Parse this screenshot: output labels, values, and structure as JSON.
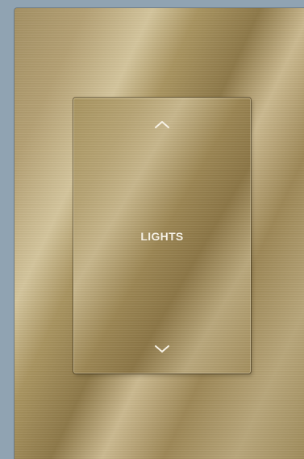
{
  "switch": {
    "label": "LIGHTS",
    "up_icon": "chevron-up-icon",
    "down_icon": "chevron-down-icon"
  },
  "colors": {
    "background": "#90a3b2",
    "metal_brass": "#b3a072",
    "label_text": "#f7f2e6"
  }
}
